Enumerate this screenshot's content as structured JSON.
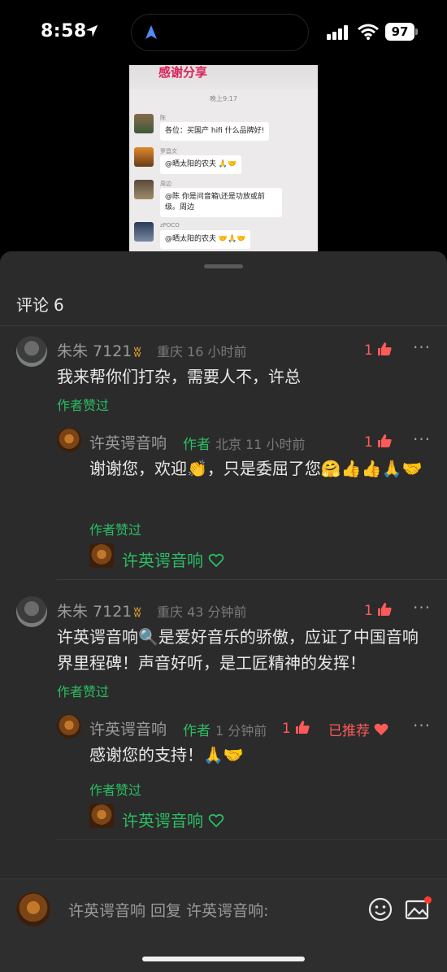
{
  "status_bar": {
    "time": "8:58",
    "battery": "97"
  },
  "preview": {
    "sticker_text": "感谢分享",
    "timestamp": "晚上9:17",
    "messages": [
      {
        "name": "陈",
        "text": "各位：买国产 hifi 什么品牌好!"
      },
      {
        "name": "罗昌文",
        "text": "@晒太阳的农夫 🙏🤝"
      },
      {
        "name": "周边",
        "text": "@陈 你是问音箱\\还是功放或前级。周边"
      },
      {
        "name": "zPOCO",
        "text": "@晒太阳的农夫 🤝🙏🤝"
      }
    ]
  },
  "comments_header": {
    "label": "评论",
    "count": "6"
  },
  "comments": [
    {
      "user": "朱朱 7121",
      "location": "重庆",
      "time": "16 小时前",
      "likes": "1",
      "text": "我来帮你们打杂，需要人不，许总",
      "author_liked": "作者赞过",
      "reply": {
        "user": "许英谔音响",
        "author_tag": "作者",
        "location": "北京",
        "time": "11 小时前",
        "likes": "1",
        "text": "谢谢您，欢迎👏，只是委屈了您🤗👍👍🙏🤝",
        "author_liked": "作者赞过",
        "sub_link": "许英谔音响"
      }
    },
    {
      "user": "朱朱 7121",
      "location": "重庆",
      "time": "43 分钟前",
      "likes": "1",
      "text": "许英谔音响🔍是爱好音乐的骄傲，应证了中国音响界里程碑！声音好听，是工匠精神的发挥！",
      "author_liked": "作者赞过",
      "reply": {
        "user": "许英谔音响",
        "author_tag": "作者",
        "time": "1 分钟前",
        "likes": "1",
        "recommended": "已推荐",
        "text": "感谢您的支持！🙏🤝",
        "author_liked": "作者赞过",
        "sub_link": "许英谔音响"
      }
    }
  ],
  "reply_bar": {
    "placeholder": "许英谔音响 回复 许英谔音响:"
  },
  "icons": {
    "thumb": "thumbs-up-icon",
    "more": "more-icon",
    "heart": "heart-icon",
    "emoji": "emoji-icon",
    "image": "image-icon"
  },
  "colors": {
    "accent_green": "#2bbd63",
    "like_red": "#ff5a5a",
    "sheet_bg": "#2b2b2b"
  }
}
